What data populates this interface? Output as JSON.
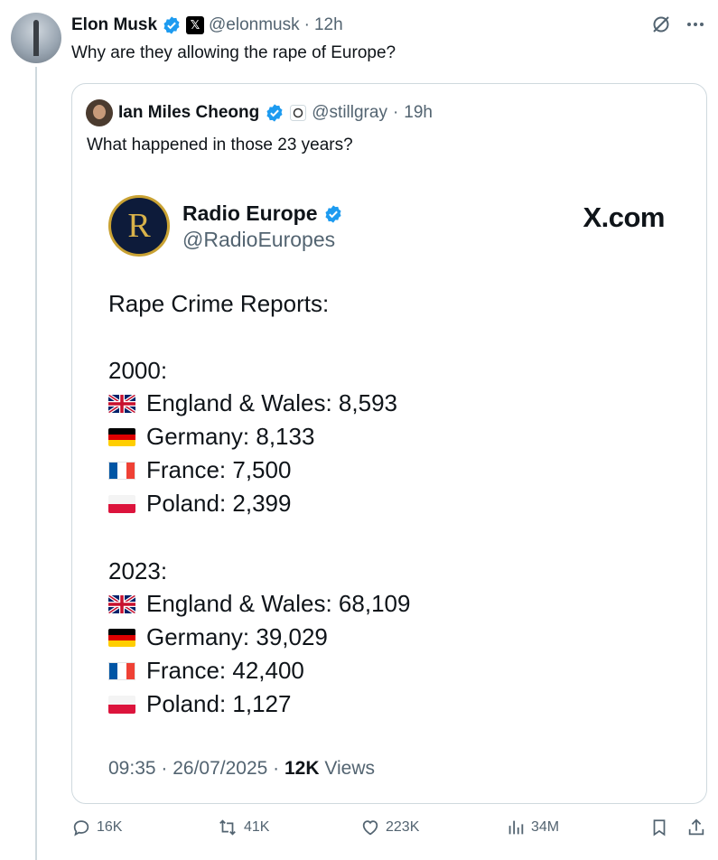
{
  "author": {
    "name": "Elon Musk",
    "handle": "@elonmusk",
    "time": "12h"
  },
  "tweet": {
    "text": "Why are they allowing the rape of Europe?"
  },
  "quote": {
    "author": {
      "name": "Ian Miles Cheong",
      "handle": "@stillgray",
      "time": "19h"
    },
    "text": "What happened in those 23 years?",
    "embed": {
      "name": "Radio Europe",
      "handle": "@RadioEuropes",
      "logo_letter": "R",
      "site": "X.com",
      "title": "Rape Crime Reports:",
      "groups": [
        {
          "year": "2000:",
          "rows": [
            {
              "flag": "uk",
              "text": "England & Wales: 8,593"
            },
            {
              "flag": "de",
              "text": "Germany: 8,133"
            },
            {
              "flag": "fr",
              "text": "France: 7,500"
            },
            {
              "flag": "pl",
              "text": "Poland: 2,399"
            }
          ]
        },
        {
          "year": "2023:",
          "rows": [
            {
              "flag": "uk",
              "text": "England & Wales: 68,109"
            },
            {
              "flag": "de",
              "text": "Germany: 39,029"
            },
            {
              "flag": "fr",
              "text": "France: 42,400"
            },
            {
              "flag": "pl",
              "text": "Poland: 1,127"
            }
          ]
        }
      ],
      "timestamp": "09:35 · 26/07/2025 ·",
      "views_count": "12K",
      "views_label": "Views"
    }
  },
  "actions": {
    "replies": "16K",
    "reposts": "41K",
    "likes": "223K",
    "views": "34M"
  },
  "colors": {
    "verified": "#1d9bf0",
    "muted": "#536471",
    "border": "#cfd9de"
  }
}
